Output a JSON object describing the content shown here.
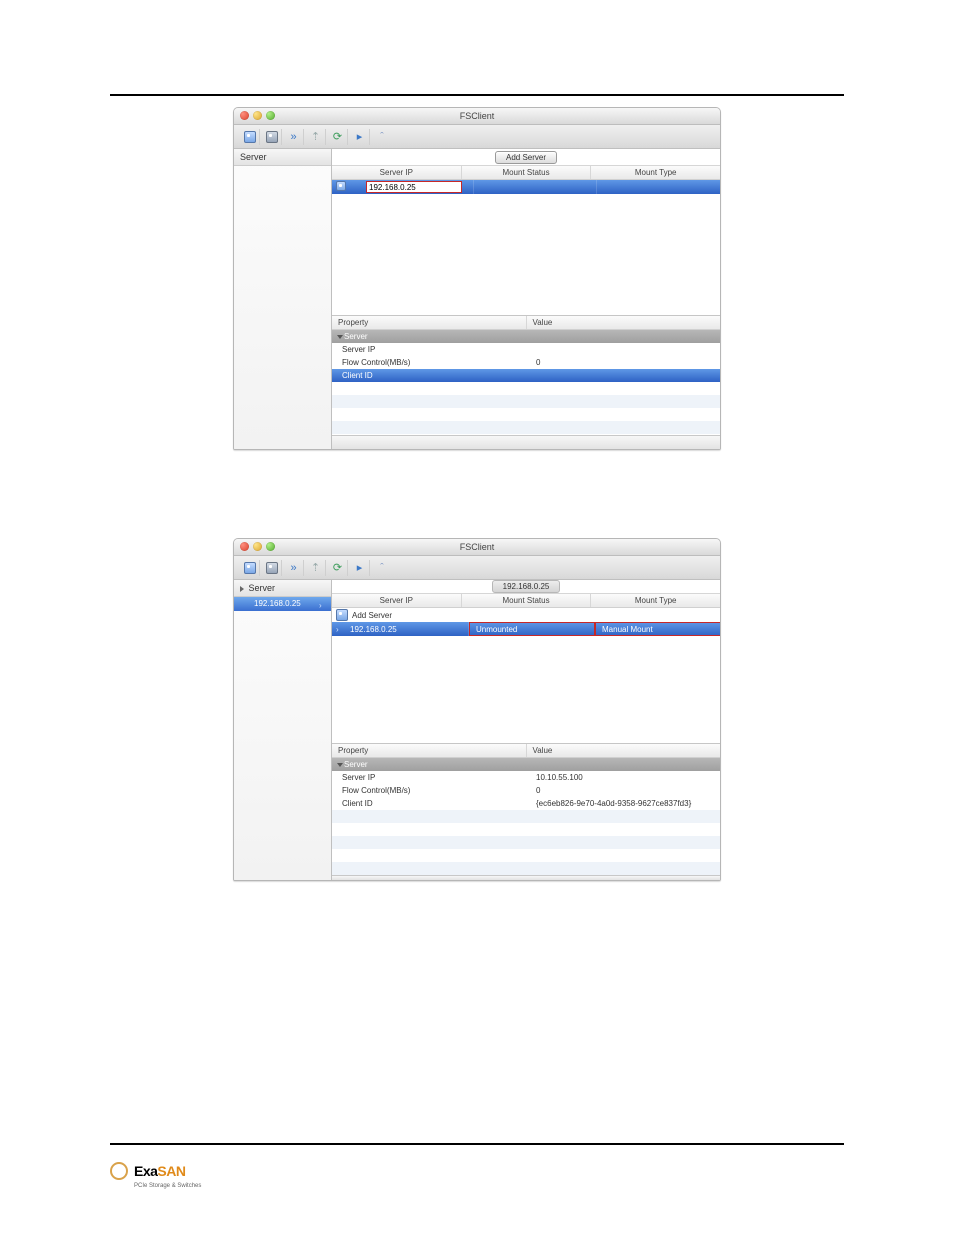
{
  "page": {
    "logo_brand_a": "Exa",
    "logo_brand_b": "SAN",
    "logo_tagline": "PCIe Storage & Switches"
  },
  "fig1": {
    "window_title": "FSClient",
    "sidebar_header": "Server",
    "main_header_button": "Add Server",
    "columns": {
      "c1": "Server IP",
      "c2": "Mount Status",
      "c3": "Mount Type"
    },
    "row_ip": "192.168.0.25",
    "props_header": {
      "p": "Property",
      "v": "Value"
    },
    "props_group": "Server",
    "props": {
      "server_ip": {
        "k": "Server IP",
        "v": ""
      },
      "flow": {
        "k": "Flow Control(MB/s)",
        "v": "0"
      },
      "client_id": {
        "k": "Client ID",
        "v": ""
      }
    }
  },
  "fig2": {
    "window_title": "FSClient",
    "sidebar_header": "Server",
    "sidebar_item": "192.168.0.25",
    "main_header_pill": "192.168.0.25",
    "columns": {
      "c1": "Server IP",
      "c2": "Mount Status",
      "c3": "Mount Type"
    },
    "add_row": "Add Server",
    "row_ip": "192.168.0.25",
    "row_status": "Unmounted",
    "row_type": "Manual Mount",
    "props_header": {
      "p": "Property",
      "v": "Value"
    },
    "props_group": "Server",
    "props": {
      "server_ip": {
        "k": "Server IP",
        "v": "10.10.55.100"
      },
      "flow": {
        "k": "Flow Control(MB/s)",
        "v": "0"
      },
      "client_id": {
        "k": "Client ID",
        "v": "{ec6eb826-9e70-4a0d-9358-9627ce837fd3}"
      }
    }
  }
}
